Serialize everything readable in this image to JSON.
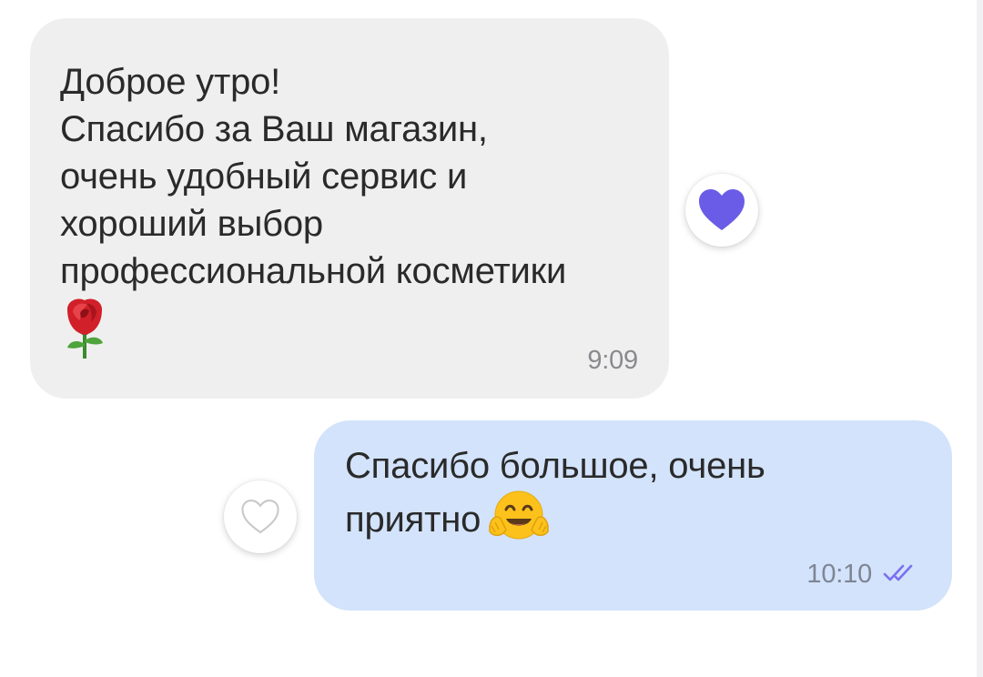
{
  "conversation": {
    "incoming_message": {
      "lines": [
        "Доброе утро!",
        "Спасибо за Ваш магазин,",
        "очень удобный сервис и",
        "хороший выбор",
        "профессиональной косметики"
      ],
      "emoji": "rose-emoji",
      "time": "9:09",
      "reaction": {
        "icon": "heart-filled-icon",
        "color": "#6a5ce6"
      }
    },
    "outgoing_message": {
      "lines": [
        "Спасибо большое, очень",
        "приятно"
      ],
      "emoji": "hugging-face-emoji",
      "time": "10:10",
      "status_icon": "double-check-icon",
      "status_color": "#7b6ff0",
      "reaction": {
        "icon": "heart-outline-icon",
        "color": "#c8c8cc"
      }
    }
  },
  "colors": {
    "incoming_bubble": "#efefef",
    "outgoing_bubble": "#d2e3fb",
    "text": "#2a2a2a"
  }
}
